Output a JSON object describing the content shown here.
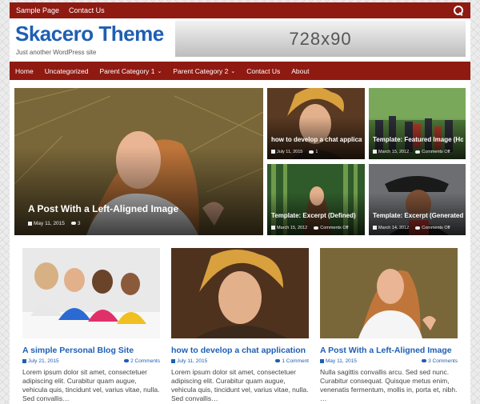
{
  "topbar": {
    "links": [
      "Sample Page",
      "Contact Us"
    ]
  },
  "header": {
    "site_title": "Skacero Theme",
    "tagline": "Just another WordPress site",
    "ad_text": "728x90"
  },
  "nav": {
    "items": [
      {
        "label": "Home",
        "has_dropdown": false
      },
      {
        "label": "Uncategorized",
        "has_dropdown": false
      },
      {
        "label": "Parent Category 1",
        "has_dropdown": true
      },
      {
        "label": "Parent Category 2",
        "has_dropdown": true
      },
      {
        "label": "Contact Us",
        "has_dropdown": false
      },
      {
        "label": "About",
        "has_dropdown": false
      }
    ]
  },
  "featured": {
    "big": {
      "title": "A Post With a Left-Aligned Image",
      "date": "May 11, 2015",
      "comments": "3"
    },
    "small": [
      {
        "title": "how to develop a chat application",
        "date": "July 11, 2015",
        "comments": "1"
      },
      {
        "title": "Template: Featured Image (Horizont",
        "date": "March 15, 2012",
        "comments": "Comments Off"
      },
      {
        "title": "Template: Excerpt (Defined)",
        "date": "March 15, 2012",
        "comments": "Comments Off"
      },
      {
        "title": "Template: Excerpt (Generated)",
        "date": "March 14, 2012",
        "comments": "Comments Off"
      }
    ]
  },
  "cards": [
    {
      "title": "A simple Personal Blog Site",
      "date": "July 21, 2015",
      "comments": "2 Comments",
      "excerpt": "Lorem ipsum dolor sit amet, consectetuer adipiscing elit. Curabitur quam augue, vehicula quis, tincidunt vel, varius vitae, nulla. Sed convallis…"
    },
    {
      "title": "how to develop a chat application",
      "date": "July 11, 2015",
      "comments": "1 Comment",
      "excerpt": "Lorem ipsum dolor sit amet, consectetuer adipiscing elit. Curabitur quam augue, vehicula quis, tincidunt vel, varius vitae, nulla. Sed convallis…"
    },
    {
      "title": "A Post With a Left-Aligned Image",
      "date": "May 11, 2015",
      "comments": "3 Comments",
      "excerpt": "Nulla sagittis convallis arcu. Sed sed nunc. Curabitur consequat. Quisque metus enim, venenatis fermentum, mollis in, porta et, nibh. …"
    }
  ],
  "colors": {
    "brand_red": "#8f1a12",
    "link_blue": "#1e5fb4"
  },
  "icons": [
    "search-icon",
    "calendar-icon",
    "comment-icon",
    "chevron-down-icon"
  ]
}
